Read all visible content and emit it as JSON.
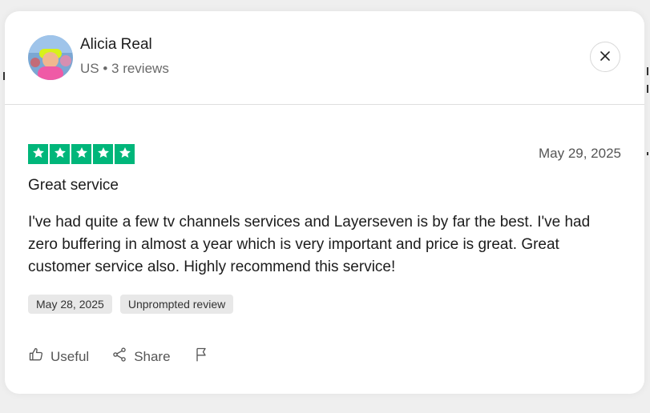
{
  "reviewer": {
    "name": "Alicia Real",
    "meta": "US • 3 reviews"
  },
  "review": {
    "rating": 5,
    "date": "May 29, 2025",
    "title": "Great service",
    "body": "I've had quite a few tv channels services and Layerseven is by far the best. I've had zero buffering in almost a year which is very important and price is great. Great customer service also. Highly recommend this service!",
    "tags": [
      "May 28, 2025",
      "Unprompted review"
    ]
  },
  "actions": {
    "useful": "Useful",
    "share": "Share"
  },
  "colors": {
    "star_green": "#00b67a"
  },
  "icons": {
    "close": "close-icon",
    "useful": "thumbs-up-icon",
    "share": "share-icon",
    "flag": "flag-icon",
    "star": "star-icon"
  }
}
